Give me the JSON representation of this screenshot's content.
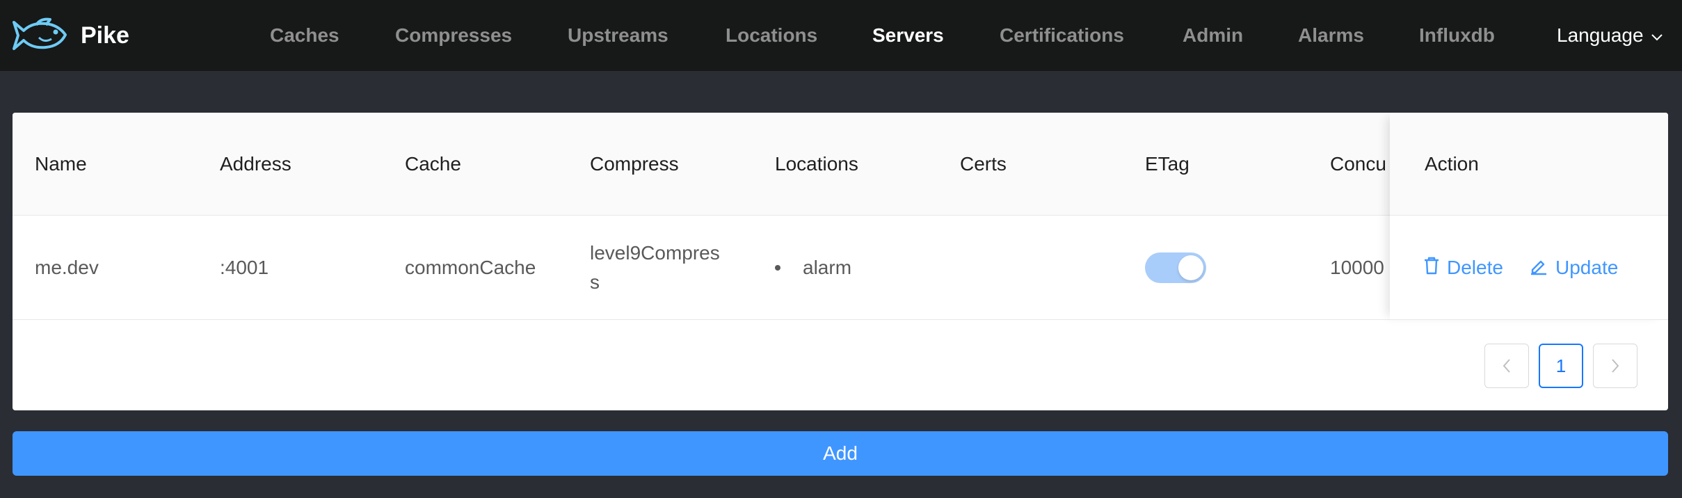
{
  "app": {
    "name": "Pike"
  },
  "nav": {
    "items": [
      {
        "label": "Caches"
      },
      {
        "label": "Compresses"
      },
      {
        "label": "Upstreams"
      },
      {
        "label": "Locations"
      },
      {
        "label": "Servers"
      },
      {
        "label": "Certifications"
      },
      {
        "label": "Admin"
      },
      {
        "label": "Alarms"
      },
      {
        "label": "Influxdb"
      }
    ],
    "active": "Servers",
    "language_label": "Language"
  },
  "table": {
    "columns": [
      "Name",
      "Address",
      "Cache",
      "Compress",
      "Locations",
      "Certs",
      "ETag",
      "Concu",
      "Action"
    ],
    "rows": [
      {
        "name": "me.dev",
        "address": ":4001",
        "cache": "commonCache",
        "compress": "level9Compress",
        "locations": [
          "alarm"
        ],
        "certs": "",
        "etag": true,
        "concurrency": "10000",
        "actions": {
          "delete": "Delete",
          "update": "Update"
        }
      }
    ]
  },
  "pagination": {
    "prev": "<",
    "current": "1",
    "next": ">"
  },
  "add_label": "Add",
  "colors": {
    "header_bg": "#171818",
    "page_bg": "#2a2d34",
    "accent": "#4096ff",
    "logo": "#6ecbf5"
  },
  "icons": [
    "pike-fish-icon",
    "chevron-down-icon",
    "trash-icon",
    "edit-icon"
  ]
}
